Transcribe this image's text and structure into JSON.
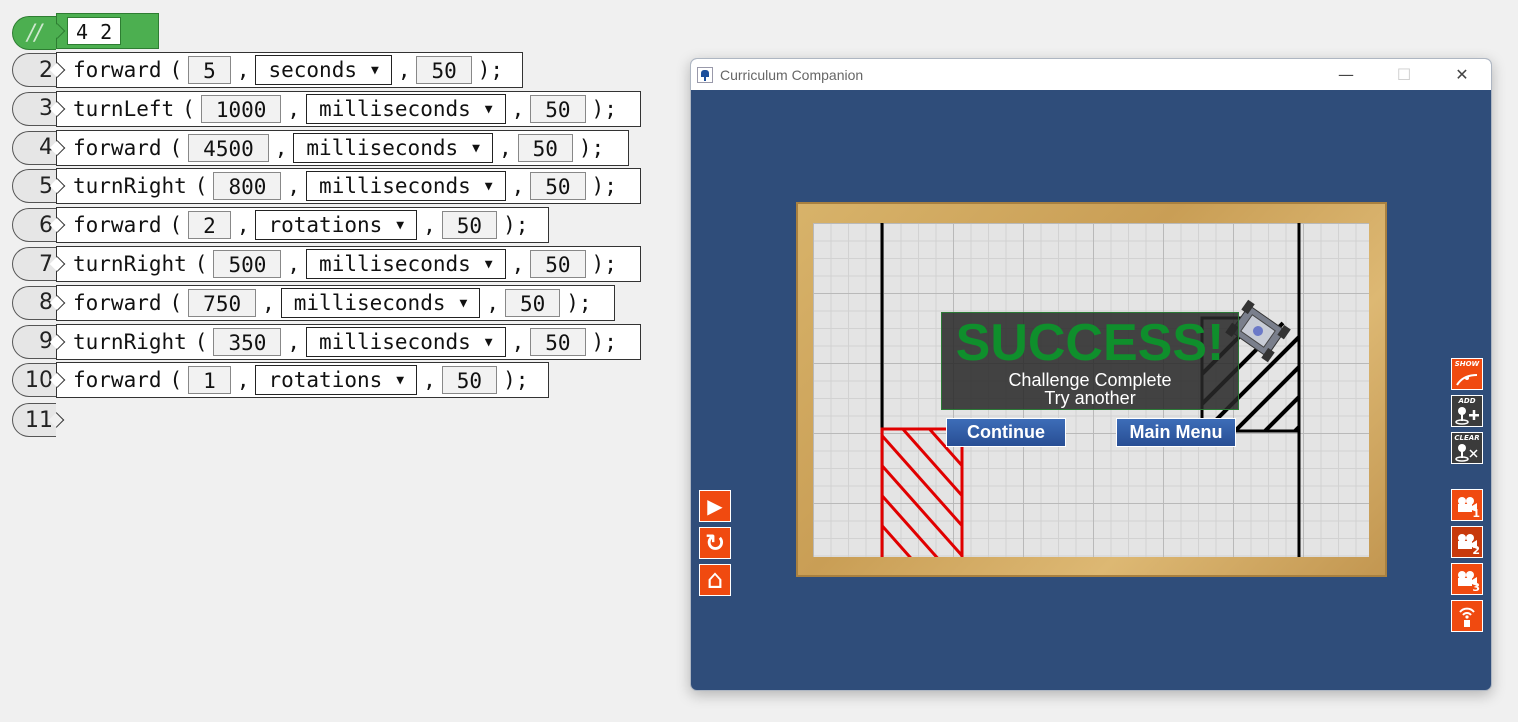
{
  "editor": {
    "comment": {
      "marker": "//",
      "text": "4 2"
    },
    "lines": [
      {
        "num": "2",
        "cmd": "forward",
        "value": "5",
        "unit": "seconds",
        "speed": "50"
      },
      {
        "num": "3",
        "cmd": "turnLeft",
        "value": "1000",
        "unit": "milliseconds",
        "speed": "50"
      },
      {
        "num": "4",
        "cmd": "forward",
        "value": "4500",
        "unit": "milliseconds",
        "speed": "50"
      },
      {
        "num": "5",
        "cmd": "turnRight",
        "value": "800",
        "unit": "milliseconds",
        "speed": "50"
      },
      {
        "num": "6",
        "cmd": "forward",
        "value": "2",
        "unit": "rotations",
        "speed": "50"
      },
      {
        "num": "7",
        "cmd": "turnRight",
        "value": "500",
        "unit": "milliseconds",
        "speed": "50"
      },
      {
        "num": "8",
        "cmd": "forward",
        "value": "750",
        "unit": "milliseconds",
        "speed": "50"
      },
      {
        "num": "9",
        "cmd": "turnRight",
        "value": "350",
        "unit": "milliseconds",
        "speed": "50"
      },
      {
        "num": "10",
        "cmd": "forward",
        "value": "1",
        "unit": "rotations",
        "speed": "50"
      }
    ],
    "empty_line_num": "11",
    "paren_open": "(",
    "comma": ",",
    "paren_close": ");"
  },
  "window": {
    "title": "Curriculum Companion",
    "minimize": "—",
    "maximize": "☐",
    "close": "✕"
  },
  "success": {
    "title": "SUCCESS!",
    "line1": "Challenge Complete",
    "line2": "Try another",
    "continue_label": "Continue",
    "main_menu_label": "Main Menu"
  },
  "left_controls": {
    "play_icon": "▶",
    "reset_icon": "↻",
    "home_icon": "⌂"
  },
  "right_controls": {
    "show_label": "SHOW",
    "add_label": "ADD",
    "clear_label": "CLEAR",
    "camera1": "1",
    "camera2": "2",
    "camera3": "3"
  },
  "colors": {
    "window_bg": "#2f4d7a",
    "success_green": "#0f8f2c",
    "button_orange": "#f04a10",
    "target_red": "#e00000",
    "comment_green": "#4caf50"
  }
}
